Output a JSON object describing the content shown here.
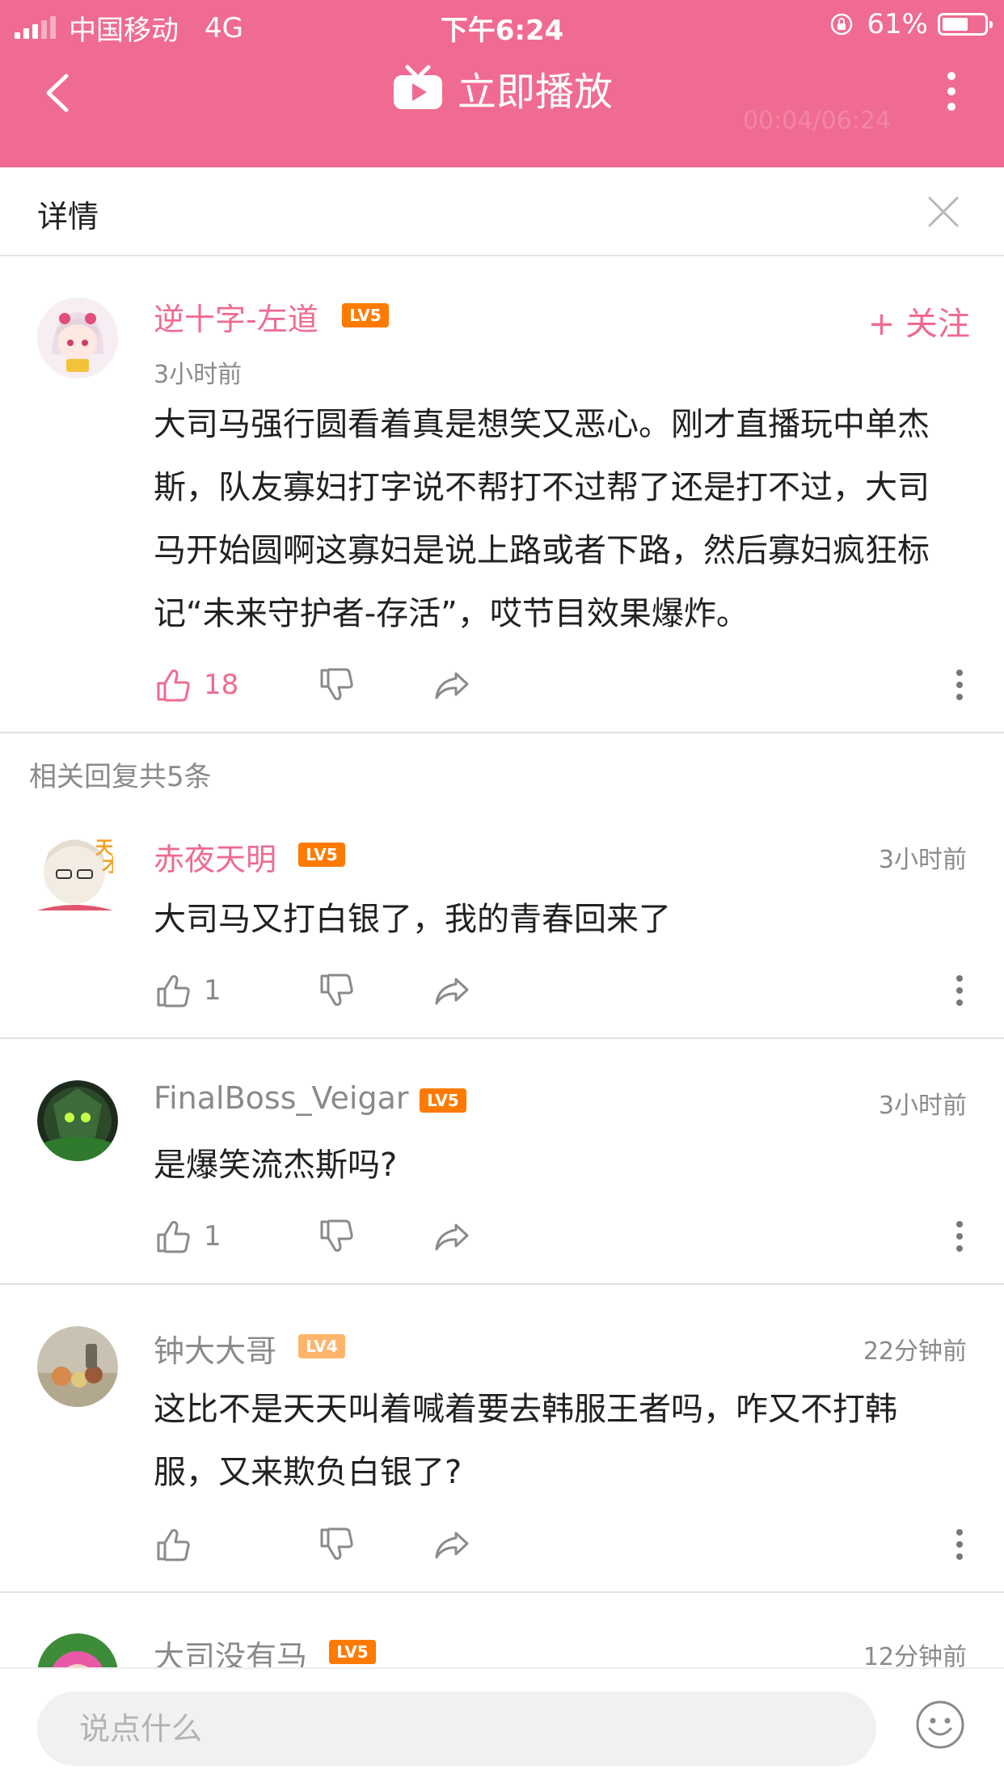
{
  "status_bar": {
    "carrier": "中国移动",
    "network": "4G",
    "time": "下午6:24",
    "battery": "61%",
    "battery_level": 0.61
  },
  "nav": {
    "title": "立即播放",
    "overlay_time": "00:04/06:24"
  },
  "detail": {
    "title": "详情"
  },
  "colors": {
    "accent": "#f06b91",
    "text": "#212121",
    "secondary": "#8a8a8a",
    "lv5": "#ff7a00",
    "lv4": "#ffb46b"
  },
  "main_comment": {
    "username": "逆十字-左道",
    "level": "LV5",
    "time": "3小时前",
    "follow_label": "+ 关注",
    "text_lines": [
      "大司马强行圆看着真是想笑又恶心。刚才直播玩中单杰",
      "斯，队友寡妇打字说不帮打不过帮了还是打不过，大司",
      "马开始圆啊这寡妇是说上路或者下路，然后寡妇疯狂标",
      "记“未来守护者-存活”，哎节目效果爆炸。"
    ],
    "likes": "18"
  },
  "related_label": "相关回复共5条",
  "replies": [
    {
      "username": "赤夜天明",
      "level": "LV5",
      "time": "3小时前",
      "text_lines": [
        "大司马又打白银了，我的青春回来了"
      ],
      "likes": "1"
    },
    {
      "username": "FinalBoss_Veigar",
      "level": "LV5",
      "time": "3小时前",
      "text_lines": [
        "是爆笑流杰斯吗?"
      ],
      "likes": "1"
    },
    {
      "username": "钟大大哥",
      "level": "LV4",
      "time": "22分钟前",
      "text_lines": [
        "这比不是天天叫着喊着要去韩服王者吗，咋又不打韩",
        "服，又来欺负白银了?"
      ],
      "likes": ""
    },
    {
      "username": "大司没有马",
      "level": "LV5",
      "time": "12分钟前",
      "text_lines": [],
      "likes": ""
    }
  ],
  "input": {
    "placeholder": "说点什么"
  }
}
